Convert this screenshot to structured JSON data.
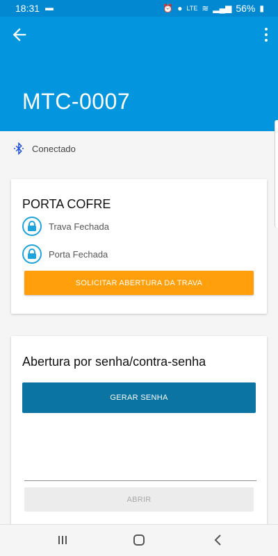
{
  "statusbar": {
    "time": "18:31",
    "battery": "56%",
    "network": "LTE"
  },
  "appbar": {
    "title": "MTC-0007"
  },
  "connection": {
    "status": "Conectado"
  },
  "card_porta": {
    "title": "PORTA COFRE",
    "lock_status": "Trava Fechada",
    "door_status": "Porta Fechada",
    "request_button": "SOLICITAR ABERTURA DA TRAVA"
  },
  "card_senha": {
    "title": "Abertura por senha/contra-senha",
    "generate_button": "GERAR SENHA",
    "input_value": "",
    "open_button": "ABRIR"
  },
  "colors": {
    "primary": "#0396df",
    "accent": "#ff9f0b",
    "dark_button": "#0b74a3"
  }
}
